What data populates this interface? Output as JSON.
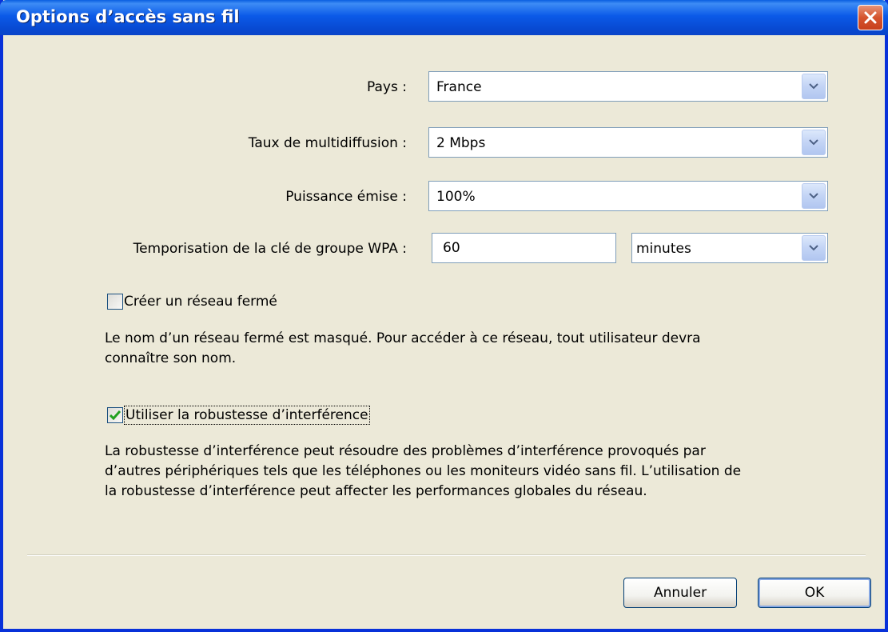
{
  "window": {
    "title": "Options d’accès sans fil"
  },
  "form": {
    "country": {
      "label": "Pays :",
      "value": "France"
    },
    "multicast": {
      "label": "Taux de multidiffusion :",
      "value": "2 Mbps"
    },
    "power": {
      "label": "Puissance émise :",
      "value": "100%"
    },
    "wpa": {
      "label": "Temporisation de la clé de groupe WPA :",
      "value": "60",
      "unit": "minutes"
    },
    "closed_network": {
      "label": "Créer un réseau fermé",
      "checked": false,
      "description_line1": "Le nom d’un réseau fermé est masqué. Pour accéder à ce réseau, tout utilisateur devra",
      "description_line2": "connaître son nom."
    },
    "interference": {
      "label": "Utiliser la robustesse d’interférence",
      "checked": true,
      "description_line1": "La robustesse d’interférence peut résoudre des problèmes d’interférence provoqués par",
      "description_line2": "d’autres périphériques tels que les téléphones ou les moniteurs vidéo sans fil. L’utilisation de",
      "description_line3": "la robustesse d’interférence peut affecter les performances globales du réseau."
    }
  },
  "buttons": {
    "cancel": "Annuler",
    "ok": "OK"
  },
  "colors": {
    "titlebar": "#0b5ae8",
    "close": "#d5542e",
    "check": "#21a121"
  },
  "icons": {
    "close": "close-icon",
    "dropdown": "chevron-down-icon",
    "check": "checkmark-icon"
  }
}
